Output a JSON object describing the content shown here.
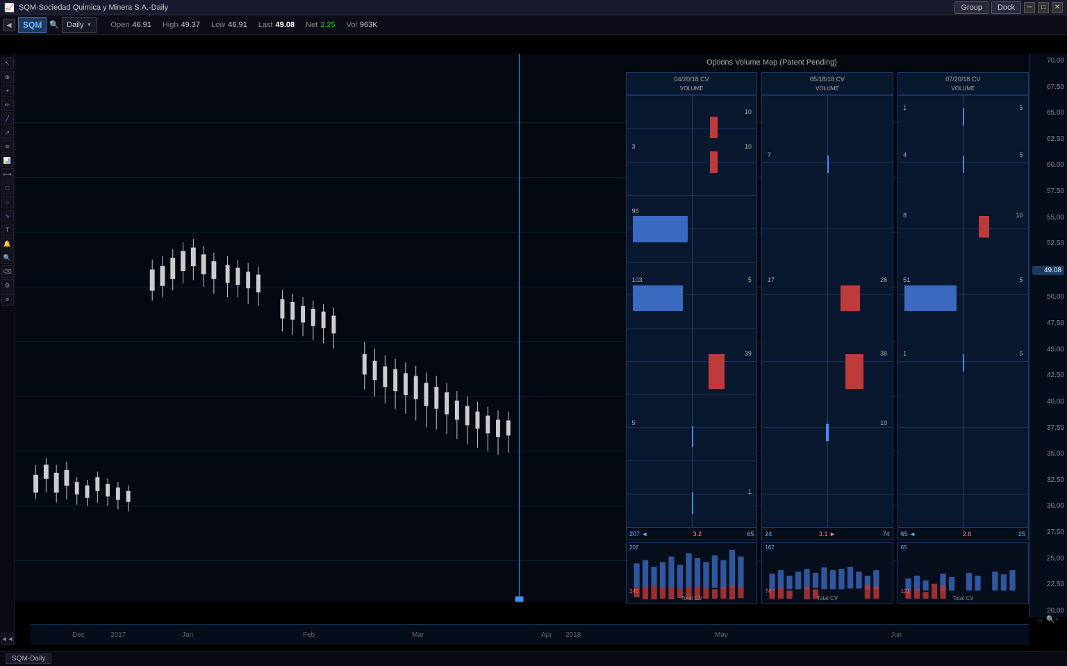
{
  "titlebar": {
    "title": "SQM-Sociedad Quimica y Minera S.A.-Daily",
    "group_label": "Group",
    "dock_label": "Dock"
  },
  "toolbar": {
    "back_arrow": "◄",
    "symbol": "SQM",
    "period": "Daily",
    "period_arrow": "▼"
  },
  "ohlc": {
    "open_label": "Open",
    "open_value": "46.91",
    "high_label": "High",
    "high_value": "49.37",
    "low_label": "Low",
    "low_value": "46.91",
    "last_label": "Last",
    "last_value": "49.08",
    "net_label": "Net",
    "net_value": "2.25",
    "vol_label": "Vol",
    "vol_value": "963K"
  },
  "options_title": "Options Volume Map (Patent Pending)",
  "panels": [
    {
      "id": "panel1",
      "date": "04/20/18 CV",
      "subtitle": "VOLUME",
      "footer_left": "207",
      "footer_mid": "3.2",
      "footer_arrow_left": "◄",
      "footer_arrow_right": "",
      "footer_right": "65",
      "hist_top": "207",
      "hist_bottom": "240",
      "hist_label": "Total CV",
      "rows": [
        {
          "price_level": "65.00",
          "left_num": "10",
          "has_blue": false,
          "has_red": true,
          "red_size": "sm"
        },
        {
          "price_level": "62.50",
          "left_num": "",
          "has_blue": false,
          "has_red": false
        },
        {
          "price_level": "60.00",
          "left_num": "3",
          "right_num": "10",
          "has_blue": false,
          "has_red": true,
          "red_size": "sm"
        },
        {
          "price_level": "57.50",
          "left_num": "",
          "has_blue": false,
          "has_red": false
        },
        {
          "price_level": "55.00",
          "left_num": "96",
          "has_blue": true,
          "blue_size": "lg",
          "has_red": false
        },
        {
          "price_level": "52.50",
          "left_num": "",
          "has_blue": false,
          "has_red": false
        },
        {
          "price_level": "50.00",
          "left_num": "103",
          "right_num": "5",
          "has_blue": true,
          "blue_size": "md",
          "has_red": false
        },
        {
          "price_level": "47.50",
          "left_num": "",
          "has_blue": false,
          "has_red": false
        },
        {
          "price_level": "45.00",
          "left_num": "",
          "right_num": "39",
          "has_blue": false,
          "has_red": true,
          "red_size": "lg"
        },
        {
          "price_level": "42.50",
          "left_num": "",
          "has_blue": false,
          "has_red": false
        },
        {
          "price_level": "40.00",
          "left_num": "5",
          "has_blue": false,
          "has_red": false,
          "has_tick": true
        },
        {
          "price_level": "37.50",
          "left_num": "",
          "has_blue": false,
          "has_red": false
        },
        {
          "price_level": "35.00",
          "left_num": "",
          "right_num": "1",
          "has_blue": false,
          "has_red": false,
          "has_tick": true
        }
      ]
    },
    {
      "id": "panel2",
      "date": "05/18/18 CV",
      "subtitle": "VOLUME",
      "footer_left": "24",
      "footer_mid": "3.1",
      "footer_arrow_left": "",
      "footer_arrow_right": "►",
      "footer_right": "74",
      "hist_top": "167",
      "hist_bottom": "74",
      "hist_label": "Total CV",
      "rows": [
        {
          "price_level": "65.00",
          "has_blue": false,
          "has_red": false
        },
        {
          "price_level": "62.50",
          "has_blue": false,
          "has_red": false
        },
        {
          "price_level": "60.00",
          "left_num": "7",
          "has_blue": false,
          "has_red": false,
          "has_tick": true
        },
        {
          "price_level": "57.50",
          "has_blue": false,
          "has_red": false
        },
        {
          "price_level": "55.00",
          "has_blue": false,
          "has_red": false
        },
        {
          "price_level": "52.50",
          "has_blue": false,
          "has_red": false
        },
        {
          "price_level": "50.00",
          "left_num": "17",
          "right_num": "26",
          "has_blue": false,
          "has_red": true,
          "red_size": "md"
        },
        {
          "price_level": "47.50",
          "has_blue": false,
          "has_red": false
        },
        {
          "price_level": "45.00",
          "right_num": "38",
          "has_blue": false,
          "has_red": true,
          "red_size": "lg"
        },
        {
          "price_level": "42.50",
          "has_blue": false,
          "has_red": false
        },
        {
          "price_level": "40.00",
          "right_num": "10",
          "has_blue": false,
          "has_red": false,
          "has_tick": true
        },
        {
          "price_level": "37.50",
          "has_blue": false,
          "has_red": false
        },
        {
          "price_level": "35.00",
          "has_blue": false,
          "has_red": false
        }
      ]
    },
    {
      "id": "panel3",
      "date": "07/20/18 CV",
      "subtitle": "VOLUME",
      "footer_left": "65",
      "footer_mid": "2.6",
      "footer_arrow_left": "◄",
      "footer_arrow_right": "",
      "footer_right": "25",
      "hist_top": "65",
      "hist_bottom": "121",
      "hist_label": "Total CV",
      "rows": [
        {
          "price_level": "65.00",
          "left_num": "1",
          "right_num": "5",
          "has_blue": false,
          "has_red": false,
          "has_tick": true
        },
        {
          "price_level": "62.50",
          "has_blue": false,
          "has_red": false
        },
        {
          "price_level": "60.00",
          "left_num": "4",
          "right_num": "5",
          "has_blue": false,
          "has_red": false,
          "has_tick": true
        },
        {
          "price_level": "57.50",
          "has_blue": false,
          "has_red": false
        },
        {
          "price_level": "55.00",
          "left_num": "8",
          "right_num": "10",
          "has_blue": false,
          "has_red": true,
          "red_size": "sm"
        },
        {
          "price_level": "52.50",
          "has_blue": false,
          "has_red": false
        },
        {
          "price_level": "50.00",
          "left_num": "51",
          "right_num": "5",
          "has_blue": true,
          "blue_size": "md",
          "has_red": false
        },
        {
          "price_level": "47.50",
          "has_blue": false,
          "has_red": false
        },
        {
          "price_level": "45.00",
          "left_num": "1",
          "right_num": "5",
          "has_blue": false,
          "has_red": false,
          "has_tick": true
        },
        {
          "price_level": "42.50",
          "has_blue": false,
          "has_red": false
        },
        {
          "price_level": "40.00",
          "has_blue": false,
          "has_red": false
        },
        {
          "price_level": "37.50",
          "has_blue": false,
          "has_red": false
        },
        {
          "price_level": "35.00",
          "has_blue": false,
          "has_red": false
        }
      ]
    }
  ],
  "price_scale": [
    "70.00",
    "67.50",
    "65.00",
    "62.50",
    "60.00",
    "57.50",
    "55.00",
    "52.50",
    "50.00",
    "47.50",
    "45.00",
    "42.50",
    "40.00",
    "37.50",
    "35.00",
    "32.50",
    "30.00",
    "27.50",
    "25.00",
    "22.50",
    "20.00"
  ],
  "current_price": "49.08",
  "time_labels": [
    {
      "label": "Dec",
      "pos": 80
    },
    {
      "label": "2017",
      "pos": 140
    },
    {
      "label": "Jan",
      "pos": 245
    },
    {
      "label": "Feb",
      "pos": 420
    },
    {
      "label": "Mar",
      "pos": 578
    },
    {
      "label": "Apr",
      "pos": 768
    },
    {
      "label": "2018",
      "pos": 800
    },
    {
      "label": "May",
      "pos": 1018
    },
    {
      "label": "Jun",
      "pos": 1272
    }
  ],
  "status_bar": {
    "tab_label": "SQM-Daily"
  }
}
